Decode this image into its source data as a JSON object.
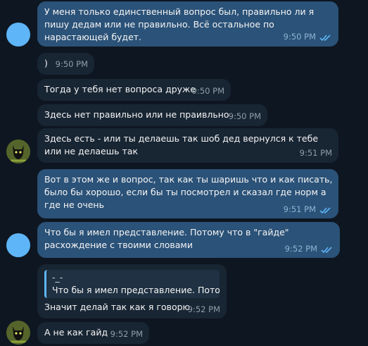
{
  "messages": [
    {
      "text": "У меня только единственный вопрос был, правильно ли я пишу дедам или не правильно. Всё остальное по нарастающей будет.",
      "time": "9:50 PM"
    },
    {
      "text": ")",
      "time": "9:50 PM"
    },
    {
      "text": "Тогда у тебя нет вопроса друже",
      "time": "9:50 PM"
    },
    {
      "text": "Здесь нет правильно или не праивльно",
      "time": "9:50 PM"
    },
    {
      "text": "Здесь есть - или ты делаешь так шоб дед вернулся к тебе или не делаешь так",
      "time": "9:51 PM"
    },
    {
      "text": "Вот в этом же и вопрос, так как ты шаришь что и как писать, было бы хорошо, если бы ты посмотрел и сказал где норм а где не очень",
      "time": "9:51 PM"
    },
    {
      "text": "Что бы я имел представление. Потому что в \"гайде\" расхождение с твоими словами",
      "time": "9:52 PM"
    },
    {
      "quote_author": "-_-",
      "quote_text": "Что бы я имел представление. Пото...",
      "text": "Значит делай так как я говорю",
      "time": "9:52 PM"
    },
    {
      "text": "А не как гайд",
      "time": "9:52 PM"
    }
  ]
}
